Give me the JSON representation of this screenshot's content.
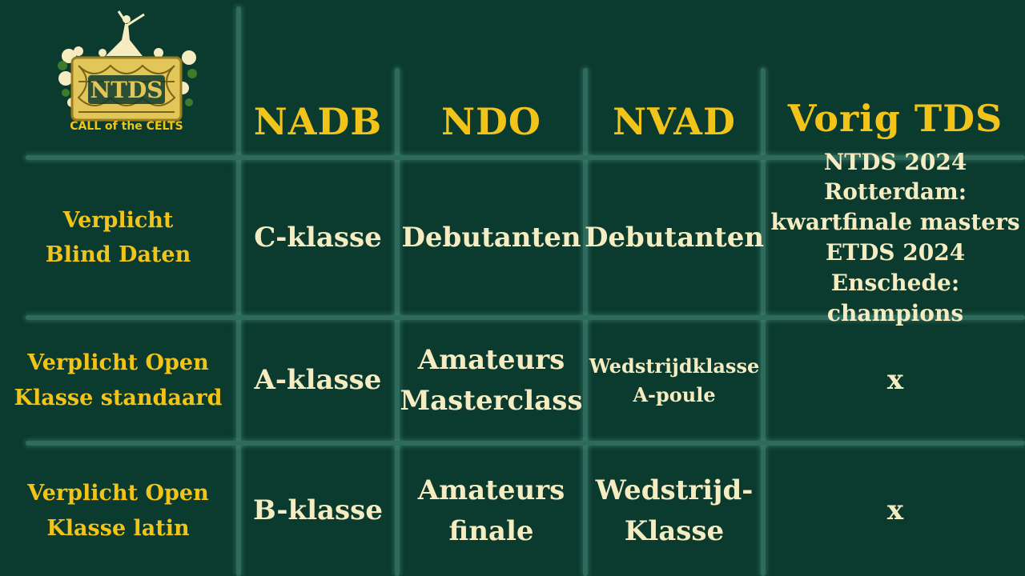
{
  "logo": {
    "emblem_text": "NTDS",
    "caption": "CALL of the CELTS"
  },
  "headers": [
    "NADB",
    "NDO",
    "NVAD",
    "Vorig TDS"
  ],
  "rows": [
    {
      "label": [
        "Verplicht",
        "Blind Daten"
      ],
      "cells": [
        [
          "C-klasse"
        ],
        [
          "Debutanten"
        ],
        [
          "Debutanten"
        ],
        [
          "NTDS 2024 Rotterdam:",
          "kwartfinale masters",
          "ETDS 2024 Enschede:",
          "champions"
        ]
      ]
    },
    {
      "label": [
        "Verplicht Open",
        "Klasse standaard"
      ],
      "cells": [
        [
          "A-klasse"
        ],
        [
          "Amateurs",
          "Masterclass"
        ],
        [
          "Wedstrijdklasse",
          "A-poule"
        ],
        [
          "x"
        ]
      ]
    },
    {
      "label": [
        "Verplicht Open",
        "Klasse latin"
      ],
      "cells": [
        [
          "B-klasse"
        ],
        [
          "Amateurs",
          "finale"
        ],
        [
          "Wedstrijd-",
          "Klasse"
        ],
        [
          "x"
        ]
      ]
    }
  ],
  "colors": {
    "background": "#0b3a2f",
    "accent_gold": "#f2c41a",
    "cream": "#f5ecc2",
    "grid": "#2f6b5c"
  }
}
